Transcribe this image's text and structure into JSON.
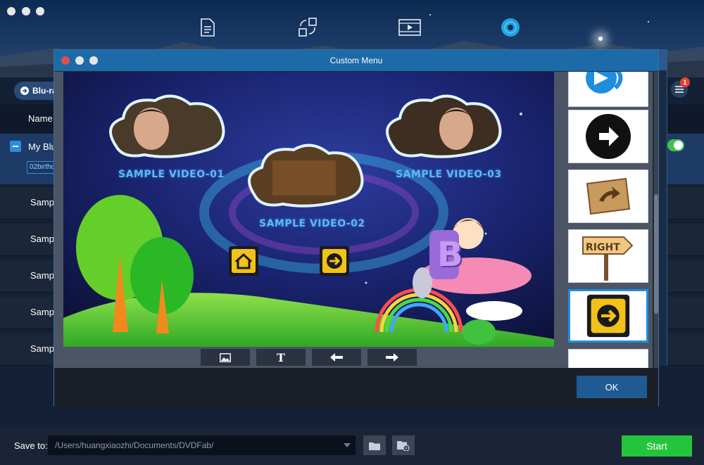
{
  "app": {
    "blu_pill_label": "Blu-ra",
    "list_header_name": "Name",
    "project_title": "My Blu",
    "file_tag": "02birthd",
    "notification_count": "1",
    "sample_rows": [
      "Sampl",
      "Sampl",
      "Sampl",
      "Sampl",
      "Sampl"
    ],
    "toolbar_icons": [
      "document-icon",
      "convert-icon",
      "video-icon",
      "disc-icon"
    ]
  },
  "dialog": {
    "title": "Custom Menu",
    "ok_label": "OK",
    "tools": [
      {
        "name": "image-tool",
        "icon": "image-icon"
      },
      {
        "name": "text-tool",
        "icon": "text-icon"
      },
      {
        "name": "prev-tool",
        "icon": "arrow-left-icon"
      },
      {
        "name": "next-tool",
        "icon": "arrow-right-icon"
      }
    ],
    "text_tool_glyph": "T",
    "canvas": {
      "clips": [
        {
          "label": "SAMPLE VIDEO-01"
        },
        {
          "label": "SAMPLE VIDEO-02"
        },
        {
          "label": "SAMPLE VIDEO-03"
        }
      ],
      "plane_letter": "B"
    },
    "thumbnails": [
      {
        "icon": "blue-arrow-icon"
      },
      {
        "icon": "black-circle-arrow-icon"
      },
      {
        "icon": "wood-arrow-icon"
      },
      {
        "icon": "right-sign-icon",
        "text": "RIGHT"
      },
      {
        "icon": "yellow-grunge-arrow-icon",
        "selected": true
      },
      {
        "icon": "brown-arrow-sign-icon"
      }
    ]
  },
  "bottom": {
    "save_label": "Save to:",
    "save_path": "/Users/huangxiaozhi/Documents/DVDFab/",
    "start_label": "Start"
  },
  "colors": {
    "accent_blue": "#1d6aa9",
    "start_green": "#25c43d",
    "label_blue": "#5fb9f0"
  }
}
